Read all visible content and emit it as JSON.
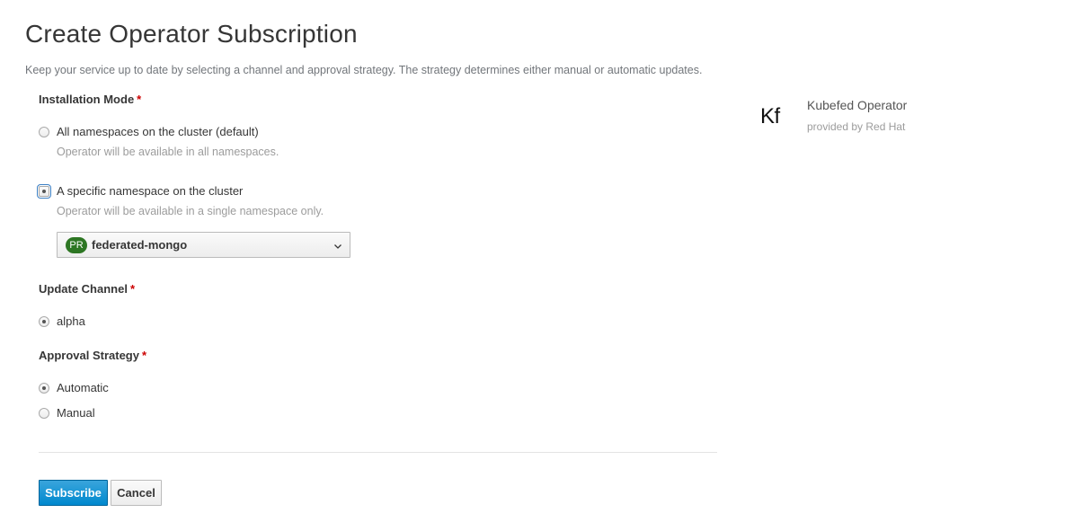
{
  "page": {
    "title": "Create Operator Subscription",
    "description": "Keep your service up to date by selecting a channel and approval strategy. The strategy determines either manual or automatic updates."
  },
  "installation_mode": {
    "label": "Installation Mode",
    "required_marker": "*",
    "options": [
      {
        "label": "All namespaces on the cluster (default)",
        "help": "Operator will be available in all namespaces.",
        "selected": false
      },
      {
        "label": "A specific namespace on the cluster",
        "help": "Operator will be available in a single namespace only.",
        "selected": true
      }
    ],
    "namespace_dropdown": {
      "badge": "PR",
      "value": "federated-mongo",
      "badge_color": "#2d7623"
    }
  },
  "update_channel": {
    "label": "Update Channel",
    "required_marker": "*",
    "options": [
      {
        "label": "alpha",
        "selected": true
      }
    ]
  },
  "approval_strategy": {
    "label": "Approval Strategy",
    "required_marker": "*",
    "options": [
      {
        "label": "Automatic",
        "selected": true
      },
      {
        "label": "Manual",
        "selected": false
      }
    ]
  },
  "actions": {
    "subscribe": "Subscribe",
    "cancel": "Cancel"
  },
  "operator": {
    "logo_text": "Kf",
    "name": "Kubefed Operator",
    "provider": "provided by Red Hat"
  },
  "colors": {
    "primary": "#0088ce",
    "required": "#cc0000"
  }
}
